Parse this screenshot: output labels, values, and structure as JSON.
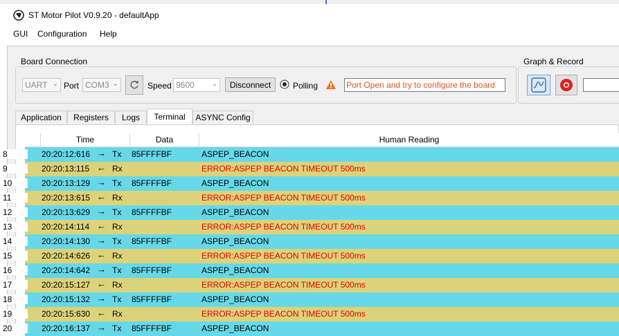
{
  "window": {
    "title": "ST Motor Pilot V0.9.20 - defaultApp"
  },
  "menu": [
    "GUI",
    "Configuration",
    "Help"
  ],
  "board_connection": {
    "title": "Board Connection",
    "interface": "UART",
    "port_label": "Port",
    "port": "COM3",
    "speed_label": "Speed",
    "speed": "9600",
    "disconnect_label": "Disconnect",
    "polling_label": "Polling",
    "status_text": "Port Open and try to configure the board"
  },
  "graph_record": {
    "title": "Graph & Record"
  },
  "tabs": [
    "Application",
    "Registers",
    "Logs",
    "Terminal",
    "ASYNC Config"
  ],
  "active_tab": "Terminal",
  "table": {
    "headers": [
      "Time",
      "Data",
      "Human Reading"
    ],
    "rows": [
      {
        "n": "8",
        "time": "20:20:12:616",
        "dir": "Tx",
        "data": "85FFFFBF",
        "reading": "ASPEP_BEACON"
      },
      {
        "n": "9",
        "time": "20:20:13:115",
        "dir": "Rx",
        "data": "",
        "reading": "ERROR:ASPEP BEACON TIMEOUT 500ms"
      },
      {
        "n": "10",
        "time": "20:20:13:129",
        "dir": "Tx",
        "data": "85FFFFBF",
        "reading": "ASPEP_BEACON"
      },
      {
        "n": "11",
        "time": "20:20:13:615",
        "dir": "Rx",
        "data": "",
        "reading": "ERROR:ASPEP BEACON TIMEOUT 500ms"
      },
      {
        "n": "12",
        "time": "20:20:13:629",
        "dir": "Tx",
        "data": "85FFFFBF",
        "reading": "ASPEP_BEACON"
      },
      {
        "n": "13",
        "time": "20:20:14:114",
        "dir": "Rx",
        "data": "",
        "reading": "ERROR:ASPEP BEACON TIMEOUT 500ms"
      },
      {
        "n": "14",
        "time": "20:20:14:130",
        "dir": "Tx",
        "data": "85FFFFBF",
        "reading": "ASPEP_BEACON"
      },
      {
        "n": "15",
        "time": "20:20:14:626",
        "dir": "Rx",
        "data": "",
        "reading": "ERROR:ASPEP BEACON TIMEOUT 500ms"
      },
      {
        "n": "16",
        "time": "20:20:14:642",
        "dir": "Tx",
        "data": "85FFFFBF",
        "reading": "ASPEP_BEACON"
      },
      {
        "n": "17",
        "time": "20:20:15:127",
        "dir": "Rx",
        "data": "",
        "reading": "ERROR:ASPEP BEACON TIMEOUT 500ms"
      },
      {
        "n": "18",
        "time": "20:20:15:132",
        "dir": "Tx",
        "data": "85FFFFBF",
        "reading": "ASPEP_BEACON"
      },
      {
        "n": "19",
        "time": "20:20:15:630",
        "dir": "Rx",
        "data": "",
        "reading": "ERROR:ASPEP BEACON TIMEOUT 500ms"
      },
      {
        "n": "20",
        "time": "20:20:16:137",
        "dir": "Tx",
        "data": "85FFFFBF",
        "reading": "ASPEP_BEACON"
      }
    ]
  },
  "icons": {
    "app": "st-logo-icon",
    "refresh": "refresh-icon",
    "warning": "warning-icon",
    "graph": "graph-icon",
    "record": "record-icon",
    "tx_arrow": "arrow-right-icon",
    "rx_arrow": "arrow-left-icon"
  },
  "colors": {
    "tx_row": "#66d8e8",
    "rx_row": "#dcd27a",
    "error_text": "#e60000",
    "status_text": "#e8541f",
    "record": "#e02020"
  }
}
